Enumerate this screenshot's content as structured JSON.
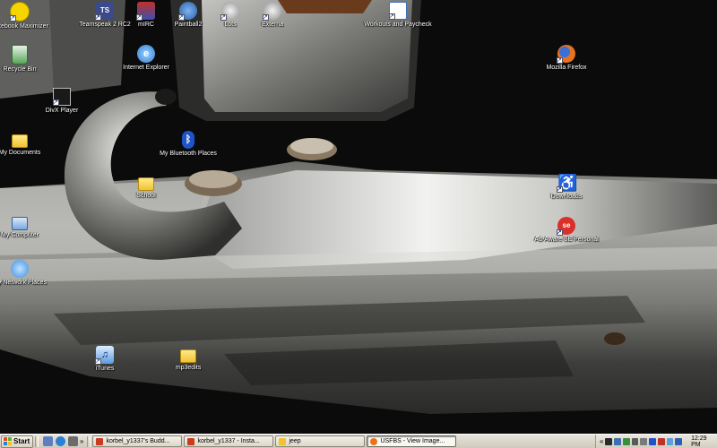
{
  "desktop": {
    "icons": [
      {
        "label": "Notebook Maximizer",
        "icon": "notebook-maximizer-icon",
        "color": "#f5d400",
        "shortcut": true
      },
      {
        "label": "Teamspeak 2 RC2",
        "icon": "teamspeak-icon",
        "color": "#3a4a8a",
        "shortcut": true
      },
      {
        "label": "mIRC",
        "icon": "mirc-icon",
        "color": "#c0302a",
        "shortcut": true
      },
      {
        "label": "Paintball2",
        "icon": "paintball-icon",
        "color": "#2a5fa8",
        "shortcut": true
      },
      {
        "label": "Lots",
        "icon": "lots-icon",
        "color": "#8e8e8e",
        "shortcut": true
      },
      {
        "label": "Externa",
        "icon": "externa-icon",
        "color": "#8e8e8e",
        "shortcut": true
      },
      {
        "label": "Workouts and Paycheck",
        "icon": "spreadsheet-icon",
        "color": "#3b6fc4",
        "shortcut": true
      },
      {
        "label": "Recycle Bin",
        "icon": "recycle-bin-icon",
        "color": "#5aa45a",
        "shortcut": false
      },
      {
        "label": "Internet Explorer",
        "icon": "internet-explorer-icon",
        "color": "#2d7fd4",
        "shortcut": false
      },
      {
        "label": "Mozilla Firefox",
        "icon": "firefox-icon",
        "color": "#e8731c",
        "shortcut": true
      },
      {
        "label": "DivX Player",
        "icon": "divx-player-icon",
        "color": "#1a1a1a",
        "shortcut": true
      },
      {
        "label": "My Documents",
        "icon": "my-documents-icon",
        "color": "#f1c232",
        "shortcut": false
      },
      {
        "label": "My Bluetooth Places",
        "icon": "bluetooth-icon",
        "color": "#1f54c8",
        "shortcut": false
      },
      {
        "label": "School",
        "icon": "folder-icon",
        "color": "#f1c232",
        "shortcut": false
      },
      {
        "label": "Downloads",
        "icon": "downloads-icon",
        "color": "#2fa12f",
        "shortcut": true
      },
      {
        "label": "Ad-Aware SE Personal",
        "icon": "ad-aware-icon",
        "color": "#d9302a",
        "shortcut": true
      },
      {
        "label": "My Computer",
        "icon": "my-computer-icon",
        "color": "#7aa7e0",
        "shortcut": false
      },
      {
        "label": "My Network Places",
        "icon": "network-places-icon",
        "color": "#3e8ee0",
        "shortcut": false
      },
      {
        "label": "iTunes",
        "icon": "itunes-icon",
        "color": "#5b9ae0",
        "shortcut": true
      },
      {
        "label": "mp3edits",
        "icon": "folder-icon",
        "color": "#f1c232",
        "shortcut": false
      }
    ]
  },
  "taskbar": {
    "start_label": "Start",
    "quick_launch": [
      {
        "icon": "show-desktop-icon",
        "color": "#5d7fbf"
      },
      {
        "icon": "internet-explorer-icon",
        "color": "#2d7fd4"
      },
      {
        "icon": "windows-media-icon",
        "color": "#6b6b6b"
      }
    ],
    "overflow": "»",
    "tasks": [
      {
        "label": "korbel_y1337's Budd...",
        "icon": "messenger-icon",
        "color": "#c93c1e",
        "active": false
      },
      {
        "label": "korbel_y1337 - Insta...",
        "icon": "messenger-icon",
        "color": "#c93c1e",
        "active": false
      },
      {
        "label": "jeep",
        "icon": "folder-icon",
        "color": "#f1c232",
        "active": false
      },
      {
        "label": "USFBS - View Image...",
        "icon": "firefox-icon",
        "color": "#e8731c",
        "active": true
      }
    ],
    "tray": {
      "expand": "«",
      "icons": [
        {
          "icon": "tray-app-icon",
          "color": "#2b2b2b"
        },
        {
          "icon": "network-tray-icon",
          "color": "#3e6fb0"
        },
        {
          "icon": "messenger-tray-icon",
          "color": "#3a8f3a"
        },
        {
          "icon": "search-tray-icon",
          "color": "#5a5a5a"
        },
        {
          "icon": "volume-tray-icon",
          "color": "#7a7a7a"
        },
        {
          "icon": "bluetooth-tray-icon",
          "color": "#1f54c8"
        },
        {
          "icon": "antivirus-tray-icon",
          "color": "#c0302a"
        },
        {
          "icon": "display-tray-icon",
          "color": "#5aa0d8"
        },
        {
          "icon": "security-tray-icon",
          "color": "#2f5fb0"
        }
      ],
      "clock": "12:29 PM"
    }
  }
}
